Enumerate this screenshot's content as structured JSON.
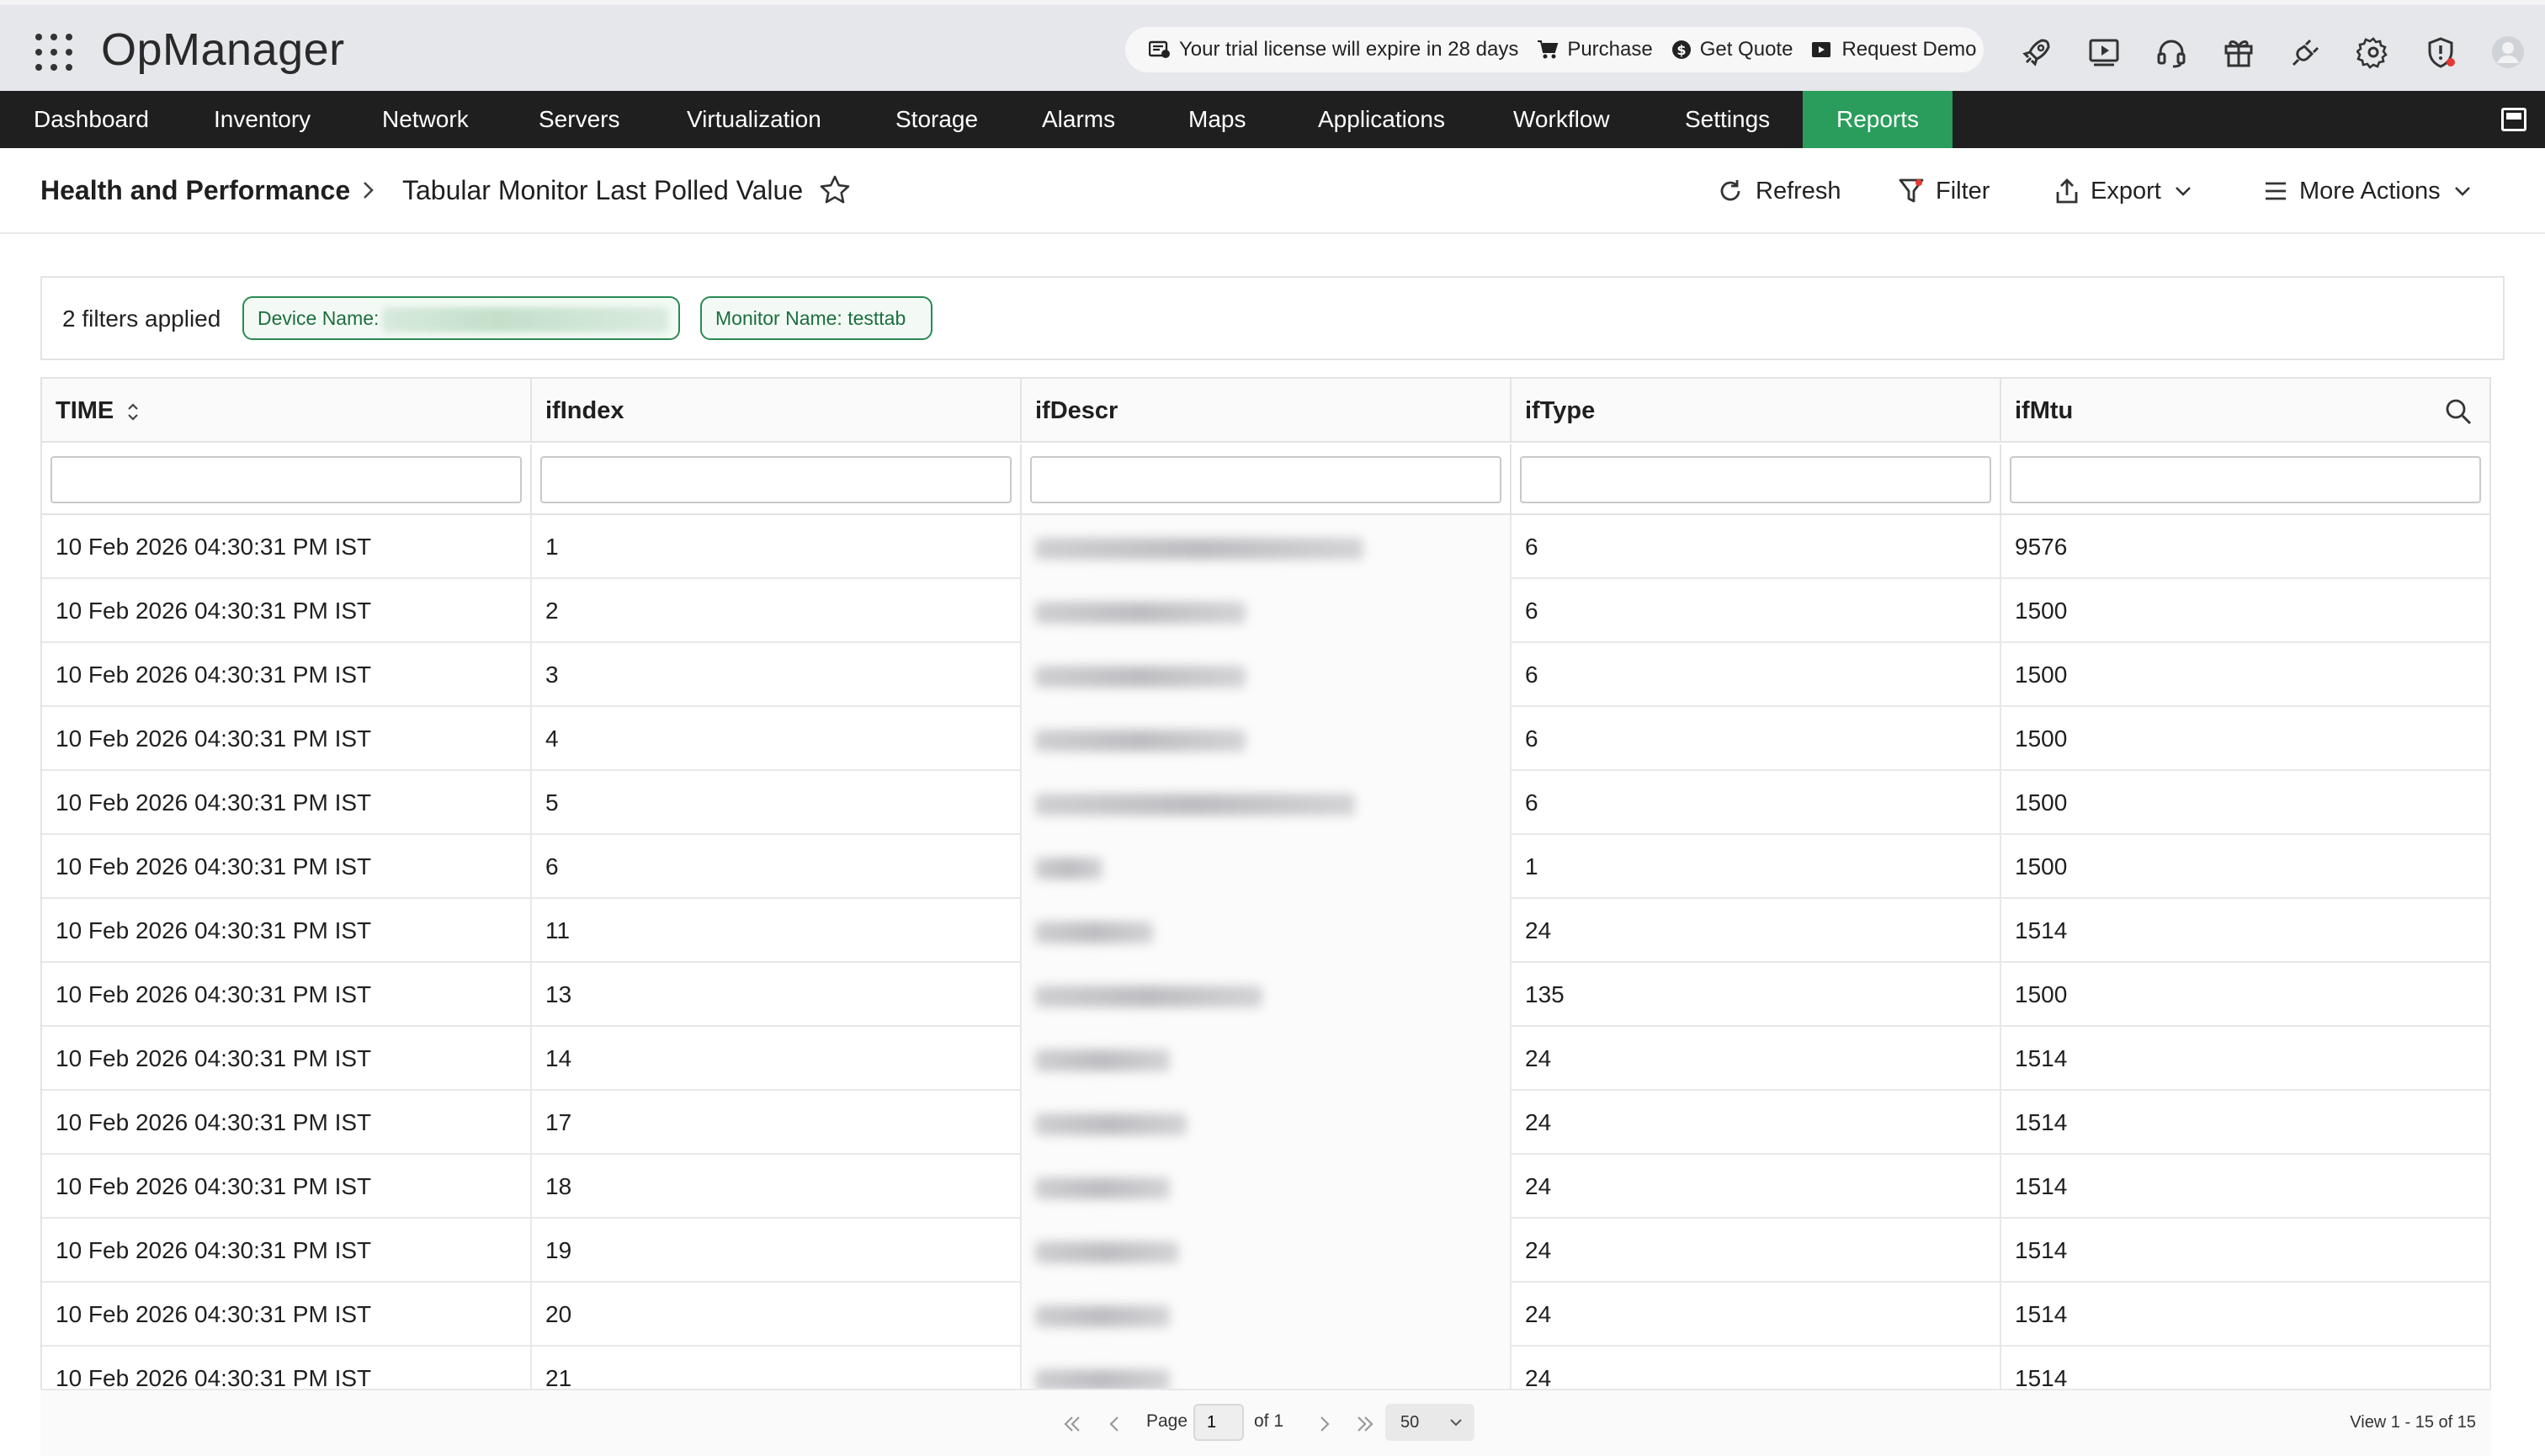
{
  "header": {
    "brand": "OpManager",
    "trial_text": "Your trial license will expire in 28 days",
    "purchase": "Purchase",
    "get_quote": "Get Quote",
    "request_demo": "Request Demo"
  },
  "nav": {
    "items": [
      "Dashboard",
      "Inventory",
      "Network",
      "Servers",
      "Virtualization",
      "Storage",
      "Alarms",
      "Maps",
      "Applications",
      "Workflow",
      "Settings",
      "Reports"
    ],
    "active": "Reports"
  },
  "breadcrumb": {
    "root": "Health and Performance",
    "current": "Tabular Monitor Last Polled Value"
  },
  "actions": {
    "refresh": "Refresh",
    "filter": "Filter",
    "export": "Export",
    "more": "More Actions"
  },
  "filters": {
    "count_label": "2 filters applied",
    "chip1_label": "Device Name:",
    "chip2_label": "Monitor Name: testtab"
  },
  "table": {
    "columns": [
      "TIME",
      "ifIndex",
      "ifDescr",
      "ifType",
      "ifMtu"
    ],
    "rows": [
      {
        "time": "10 Feb 2026 04:30:31 PM IST",
        "ifIndex": "1",
        "ifType": "6",
        "ifMtu": "9576"
      },
      {
        "time": "10 Feb 2026 04:30:31 PM IST",
        "ifIndex": "2",
        "ifType": "6",
        "ifMtu": "1500"
      },
      {
        "time": "10 Feb 2026 04:30:31 PM IST",
        "ifIndex": "3",
        "ifType": "6",
        "ifMtu": "1500"
      },
      {
        "time": "10 Feb 2026 04:30:31 PM IST",
        "ifIndex": "4",
        "ifType": "6",
        "ifMtu": "1500"
      },
      {
        "time": "10 Feb 2026 04:30:31 PM IST",
        "ifIndex": "5",
        "ifType": "6",
        "ifMtu": "1500"
      },
      {
        "time": "10 Feb 2026 04:30:31 PM IST",
        "ifIndex": "6",
        "ifType": "1",
        "ifMtu": "1500"
      },
      {
        "time": "10 Feb 2026 04:30:31 PM IST",
        "ifIndex": "11",
        "ifType": "24",
        "ifMtu": "1514"
      },
      {
        "time": "10 Feb 2026 04:30:31 PM IST",
        "ifIndex": "13",
        "ifType": "135",
        "ifMtu": "1500"
      },
      {
        "time": "10 Feb 2026 04:30:31 PM IST",
        "ifIndex": "14",
        "ifType": "24",
        "ifMtu": "1514"
      },
      {
        "time": "10 Feb 2026 04:30:31 PM IST",
        "ifIndex": "17",
        "ifType": "24",
        "ifMtu": "1514"
      },
      {
        "time": "10 Feb 2026 04:30:31 PM IST",
        "ifIndex": "18",
        "ifType": "24",
        "ifMtu": "1514"
      },
      {
        "time": "10 Feb 2026 04:30:31 PM IST",
        "ifIndex": "19",
        "ifType": "24",
        "ifMtu": "1514"
      },
      {
        "time": "10 Feb 2026 04:30:31 PM IST",
        "ifIndex": "20",
        "ifType": "24",
        "ifMtu": "1514"
      },
      {
        "time": "10 Feb 2026 04:30:31 PM IST",
        "ifIndex": "21",
        "ifType": "24",
        "ifMtu": "1514"
      }
    ]
  },
  "pagination": {
    "page_label": "Page",
    "page_value": "1",
    "of_label": "of 1",
    "page_size": "50",
    "view_text": "View 1 - 15 of 15"
  },
  "colors": {
    "nav_bg": "#1f1f1f",
    "active_tab": "#2a9d5c",
    "chip_border": "#2a8a52"
  }
}
